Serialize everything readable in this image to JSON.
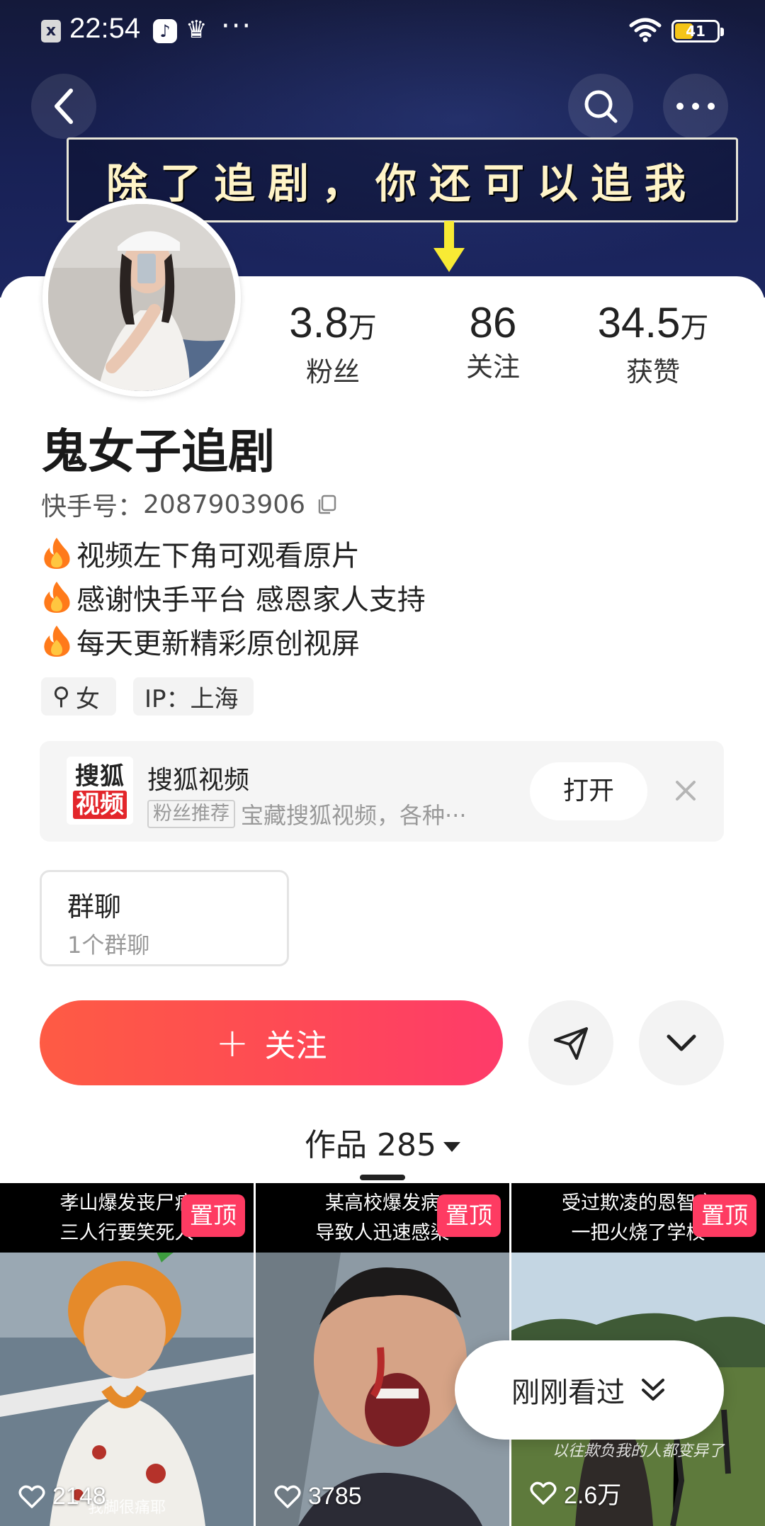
{
  "status_bar": {
    "time": "22:54",
    "battery": "41",
    "more_glyph": "···",
    "x_glyph": "x",
    "tiktok_glyph": "♪",
    "crown_glyph": "♛"
  },
  "header": {
    "slogan": "除了追剧，你还可以追我"
  },
  "profile": {
    "stats": {
      "fans_value": "3.8",
      "fans_unit": "万",
      "fans_label": "粉丝",
      "follow_value": "86",
      "follow_label": "关注",
      "likes_value": "34.5",
      "likes_unit": "万",
      "likes_label": "获赞"
    },
    "nickname": "鬼女子追剧",
    "kuaishou_id_label": "快手号：",
    "kuaishou_id": "2087903906",
    "bio": [
      "视频左下角可观看原片",
      "感谢快手平台 感恩家人支持",
      "每天更新精彩原创视屏"
    ],
    "tags": {
      "gender_icon": "⚲",
      "gender": "女",
      "ip": "IP：上海"
    }
  },
  "promo": {
    "logo_line1": "搜狐",
    "logo_line2": "视频",
    "title": "搜狐视频",
    "badge": "粉丝推荐",
    "description": "宝藏搜狐视频，各种···",
    "open_label": "打开"
  },
  "group_chat": {
    "title": "群聊",
    "subtitle": "1个群聊"
  },
  "actions": {
    "follow_label": "关注",
    "plus": "+"
  },
  "works": {
    "label": "作品 285"
  },
  "videos": [
    {
      "caption_line1": "孝山爆发丧尸病",
      "caption_line2": "三人行要笑死人",
      "pin_label": "置顶",
      "likes": "2148",
      "subtitle": "我脚很痛耶"
    },
    {
      "caption_line1": "某高校爆发病",
      "caption_line2": "导致人迅速感染",
      "pin_label": "置顶",
      "likes": "3785",
      "subtitle": ""
    },
    {
      "caption_line1": "受过欺凌的恩智变",
      "caption_line2": "一把火烧了学校",
      "pin_label": "置顶",
      "likes": "2.6万",
      "subtitle": "以往欺负我的人都变异了"
    }
  ],
  "recent_pill": {
    "label": "刚刚看过"
  },
  "colors": {
    "follow_gradient_start": "#fe5b44",
    "follow_gradient_end": "#fe3b6a",
    "pin_badge": "#fe3b62",
    "header_bg": "#182155"
  }
}
